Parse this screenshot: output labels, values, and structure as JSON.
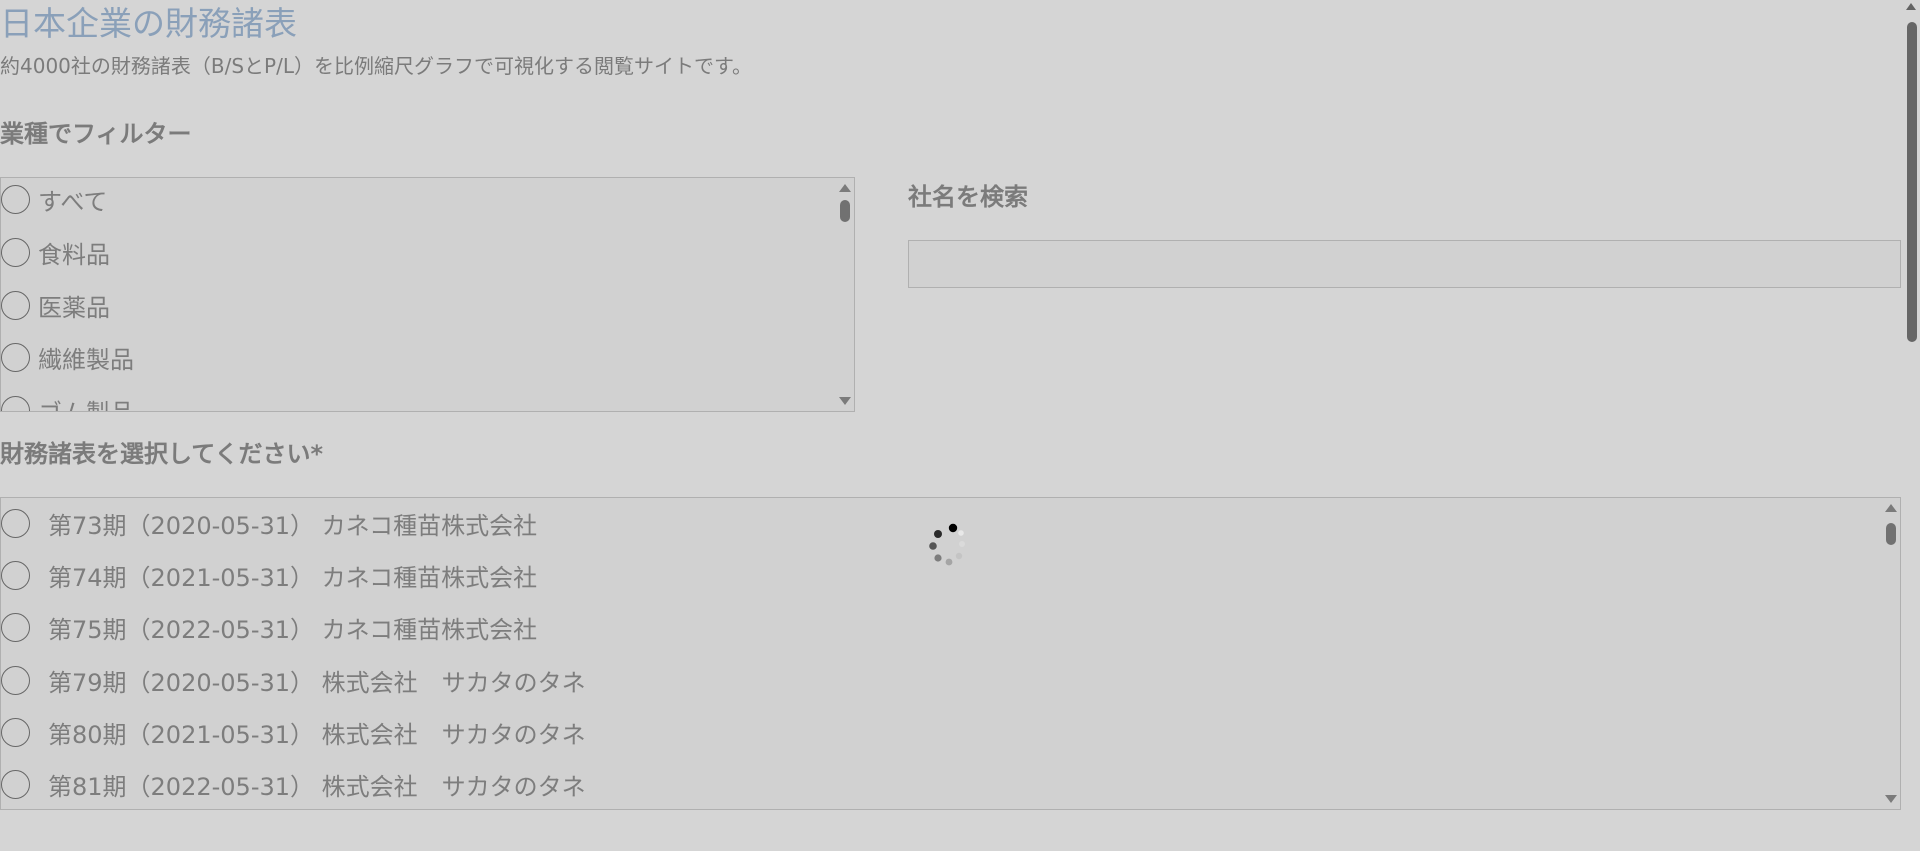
{
  "header": {
    "title": "日本企業の財務諸表",
    "subtitle": "約4000社の財務諸表（B/SとP/L）を比例縮尺グラフで可視化する閲覧サイトです。"
  },
  "industry_filter": {
    "heading": "業種でフィルター",
    "options": [
      "すべて",
      "食料品",
      "医薬品",
      "繊維製品",
      "ゴム製品"
    ]
  },
  "search": {
    "heading": "社名を検索",
    "value": ""
  },
  "statements": {
    "heading": "財務諸表を選択してください*",
    "options": [
      "第73期（2020-05-31） カネコ種苗株式会社",
      "第74期（2021-05-31） カネコ種苗株式会社",
      "第75期（2022-05-31） カネコ種苗株式会社",
      "第79期（2020-05-31） 株式会社　サカタのタネ",
      "第80期（2021-05-31） 株式会社　サカタのタネ",
      "第81期（2022-05-31） 株式会社　サカタのタネ"
    ]
  },
  "loading": {
    "icon": "loading-spinner-icon"
  }
}
